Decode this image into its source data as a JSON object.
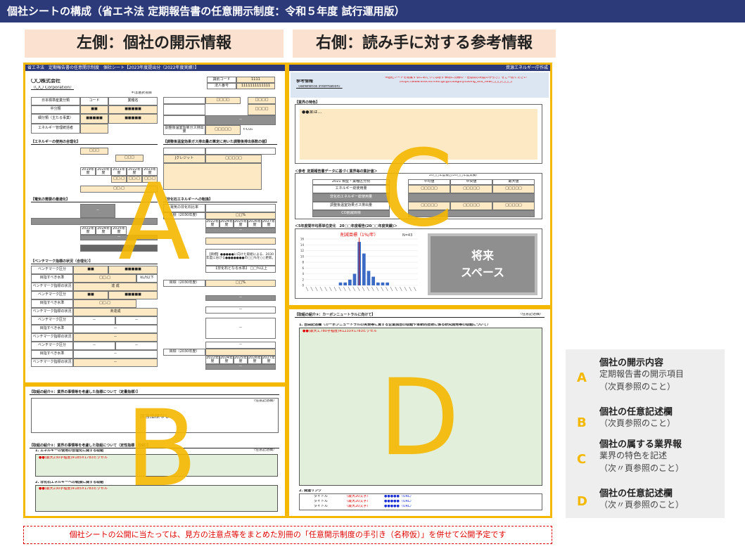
{
  "title": "個社シートの構成（省エネ法 定期報告書の任意開示制度：令和５年度 試行運用版）",
  "left_header": "左側：個社の開示情報",
  "right_header": "右側：読み手に対する参考情報",
  "big_letters": {
    "a": "A",
    "b": "B",
    "c": "C",
    "d": "D"
  },
  "left_sheet": {
    "bar_title": "省エネ法　定期報告書の任意開示制度　個社シート【2023年度提出分（2022年度実績）】",
    "company": "〇〇株式会社",
    "company_en": "（〇〇 Corporation）",
    "corp_code_label": "法人番号",
    "corp_code_value": "1111111111111",
    "id_label": "識別コード",
    "id_value": "1111",
    "note": "＊は選択項目",
    "sec_energy": "【エネルギーの使用の合理化】",
    "sec_power": "【電気の需要の最適化】",
    "sec_bench": "【ベンチマーク指標の状況（合理化）】",
    "sec_ghg": "【調整後温室効果ガス排出量の算定に用いた調整後排出係数の値】",
    "sec_nonfossil": "【非化石エネルギーへの転換】",
    "ghg_label": "調整後温室効果ガス排出量",
    "unit_co2": "t-CO₂",
    "years": [
      "2019年度",
      "2020年度",
      "2021年度",
      "2022年度",
      "2023年度"
    ],
    "years2": [
      "2022年度",
      "2024年度",
      "2025年度",
      "2026年度",
      "2027年度"
    ],
    "row_labels": [
      "日本標準産業分類",
      "中分類",
      "細分類（主たる事業）",
      "エネルギー管理統括者"
    ],
    "row_values": [
      "コード",
      "業種名",
      "■■",
      "■■■■■",
      "■■■■■",
      "■■■■■"
    ],
    "sq": "□□□□",
    "sq2": "□□.□",
    "sq3": "□□□□□",
    "dash": "－",
    "pct": "□□%",
    "sqs": [
      "□□□",
      "□□□",
      "□□.□",
      "□□.□",
      "□□.□"
    ],
    "bench_rows": [
      "ベンチマーク区分",
      "目指すべき水準",
      "ベンチマーク指標の状況",
      "ベンチマーク区分",
      "目指すべき水準",
      "ベンチマーク指標の状況"
    ],
    "bench_vals": [
      "■■",
      "■■■■■",
      "□□.□",
      "kL/t以下",
      "達 成",
      "未達成"
    ],
    "target_label": "目標（2030年度）",
    "plan_text": "【目標】●●●●●に向けた取組による、2030年度における●●●●●●●の□□％を○○更新。",
    "plan_text2": "【非化石となる水準】 □□％以上",
    "jcredit": "Jクレジット",
    "electricity_label": "電気の非化石比率"
  },
  "right_sheet": {
    "bar_right": "資源エネルギー庁作成",
    "ref_title": "参考情報",
    "ref_en": "（Reference information）",
    "warning": "※個社シートを閲覧するにあたっては必ず事前に別冊の「任意開示制度の手引き」をご一読ください",
    "warning_url": "（https://www.enecho.meti.go.jp/category/saving_and_new/□□□/□□□）",
    "industry_label": "【業界の特色】",
    "industry_text": "●●業は…",
    "stats_title": "＜参考_定期報告書データに基づく業界毎の集計値＞",
    "stats_sub": "20□□年度報告(20□□年度実績)",
    "stats_cols": [
      "平均値",
      "中央値",
      "最大値"
    ],
    "stats_rows": [
      "エネルギー総使用量",
      "非化石エネルギー総使用量",
      "調整後温室効果ガス排出量",
      "CO削減目標"
    ],
    "stats_head": "2021 類型・業種区分別",
    "chart_title": "＜5年度間平均原単位変化　20□□年度報告(20□□年度実績)＞",
    "chart_label": "削減目標（1%/年）",
    "chart_n": "N=43",
    "future": "将来\nスペース",
    "future_line1": "将来",
    "future_line2": "スペース"
  },
  "section_b": {
    "title1": "【取組の紹介①：業界の事情等を考慮した指標について（定量指標）】",
    "optional": "（任意記述欄）",
    "none": "該当指標なし",
    "title2": "【取組の紹介②：業界の事情等を考慮した取組について（定性指標・取組）】",
    "sub1": "1. エネルギーの使用の合理化に関する取組",
    "sub2": "2. 非化石エネルギーへの転換に関する取組",
    "red_text": "●●(最大230字程度)※185×1783ピクセル"
  },
  "section_d": {
    "title": "【取組の紹介③：カーボンニュートラルに向けて】",
    "optional": "（任意記述欄）",
    "sub": "1. 自由記述欄（カーボンニュートラルの実現等に資する企業独自の取組や革新的技術に係る研究開発等の取組について）",
    "red_text": "●●(最大1,780字程度)※1233×1783ピクセル",
    "links_title": "2. 関連リンク",
    "link_title": "タイトル",
    "link_max": "（最大20文字）",
    "link_url": "●●●●●（URL）"
  },
  "legend": [
    {
      "letter": "A",
      "title": "個社の開示内容",
      "sub": "定期報告書の開示項目\n（次頁参照のこと）"
    },
    {
      "letter": "B",
      "title": "個社の任意記述欄",
      "sub": "（次頁参照のこと）"
    },
    {
      "letter": "C",
      "title": "個社の属する業界報",
      "sub": "業界の特色を記述\n（次〃頁参照のこと）"
    },
    {
      "letter": "D",
      "title": "個社の任意記述欄",
      "sub": "（次〃頁参照のこと）"
    }
  ],
  "footer": "個社シートの公開に当たっては、見方の注意点等をまとめた別冊の「任意開示制度の手引き（名称仮）」を併せて公開予定です",
  "colors": {
    "accent": "#f5b800",
    "navy": "#2d3a7a",
    "header_bg": "#fbe1cf",
    "alert": "#e00000"
  },
  "chart_data": {
    "type": "bar",
    "title": "削減目標（1%/年）",
    "annotation": "N=43",
    "y_ticks": [
      0,
      2,
      4,
      6,
      8,
      10,
      12,
      14,
      16
    ],
    "ylim": [
      0,
      16
    ],
    "values": [
      0,
      0,
      0,
      0,
      0,
      0,
      0,
      1,
      1,
      2,
      4,
      15,
      11,
      5,
      3,
      1,
      1,
      1,
      0,
      0,
      0,
      0,
      0,
      0
    ],
    "color": "#3b6bc4"
  }
}
